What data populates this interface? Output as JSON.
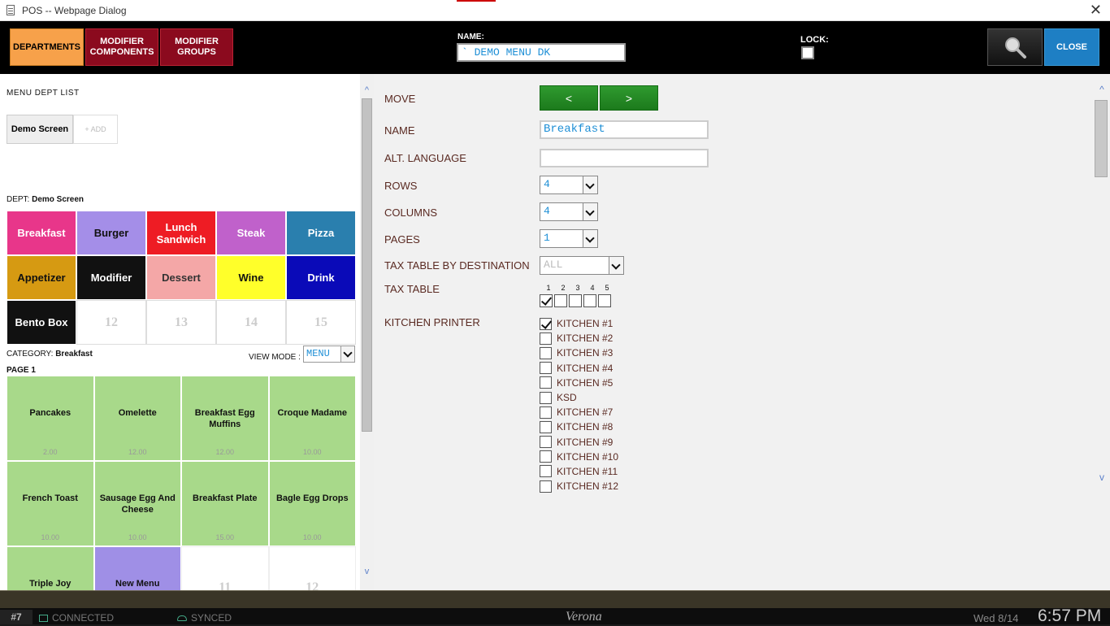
{
  "window": {
    "title": "POS -- Webpage Dialog"
  },
  "toolbar": {
    "departments": "DEPARTMENTS",
    "modifier_components": "MODIFIER COMPONENTS",
    "modifier_groups": "MODIFIER GROUPS",
    "name_label": "NAME:",
    "name_value": "` DEMO MENU DK",
    "lock_label": "LOCK:",
    "close": "CLOSE"
  },
  "left": {
    "menu_dept_list": "MENU DEPT LIST",
    "tab_demo": "Demo Screen",
    "tab_add": "+ ADD",
    "dept_prefix": "DEPT: ",
    "dept_value": "Demo Screen",
    "departments": [
      {
        "label": "Breakfast",
        "color": "#e8368a"
      },
      {
        "label": "Burger",
        "color": "#a48ee8",
        "text": "#111"
      },
      {
        "label": "Lunch Sandwich",
        "color": "#ee1c24"
      },
      {
        "label": "Steak",
        "color": "#c061cb"
      },
      {
        "label": "Pizza",
        "color": "#2a7fae"
      },
      {
        "label": "Appetizer",
        "color": "#d69a12",
        "text": "#111"
      },
      {
        "label": "Modifier",
        "color": "#111111"
      },
      {
        "label": "Dessert",
        "color": "#f4a7a7",
        "text": "#333"
      },
      {
        "label": "Wine",
        "color": "#ffff2a",
        "text": "#111"
      },
      {
        "label": "Drink",
        "color": "#0a0ab8"
      },
      {
        "label": "Bento Box",
        "color": "#111111"
      },
      {
        "label": "12",
        "empty": true
      },
      {
        "label": "13",
        "empty": true
      },
      {
        "label": "14",
        "empty": true
      },
      {
        "label": "15",
        "empty": true
      }
    ],
    "category_prefix": "CATEGORY: ",
    "category_value": "Breakfast",
    "view_mode_label": "VIEW MODE :",
    "view_mode_value": "MENU",
    "page_label": "PAGE 1",
    "items": [
      {
        "name": "Pancakes",
        "price": "2.00"
      },
      {
        "name": "Omelette",
        "price": "12.00"
      },
      {
        "name": "Breakfast Egg Muffins",
        "price": "12.00"
      },
      {
        "name": "Croque Madame",
        "price": "10.00"
      },
      {
        "name": "French Toast",
        "price": "10.00"
      },
      {
        "name": "Sausage Egg And Cheese",
        "price": "10.00"
      },
      {
        "name": "Breakfast Plate",
        "price": "15.00"
      },
      {
        "name": "Bagle Egg Drops",
        "price": "10.00"
      },
      {
        "name": "Triple Joy",
        "price": ""
      },
      {
        "name": "New Menu",
        "price": "",
        "purple": true
      },
      {
        "name": "11",
        "empty": true
      },
      {
        "name": "12",
        "empty": true
      }
    ]
  },
  "right": {
    "move_label": "MOVE",
    "move_left": "<",
    "move_right": ">",
    "name_label": "NAME",
    "name_value": "Breakfast",
    "alt_language_label": "ALT. LANGUAGE",
    "alt_language_value": "",
    "rows_label": "ROWS",
    "rows_value": "4",
    "columns_label": "COLUMNS",
    "columns_value": "4",
    "pages_label": "PAGES",
    "pages_value": "1",
    "tax_dest_label": "TAX TABLE BY DESTINATION",
    "tax_dest_value": "ALL",
    "tax_table_label": "TAX TABLE",
    "tax_numbers": [
      "1",
      "2",
      "3",
      "4",
      "5"
    ],
    "tax_checked": [
      true,
      false,
      false,
      false,
      false
    ],
    "kitchen_printer_label": "KITCHEN PRINTER",
    "kitchens": [
      {
        "label": "KITCHEN #1",
        "checked": true
      },
      {
        "label": "KITCHEN #2",
        "checked": false
      },
      {
        "label": "KITCHEN #3",
        "checked": false
      },
      {
        "label": "KITCHEN #4",
        "checked": false
      },
      {
        "label": "KITCHEN #5",
        "checked": false
      },
      {
        "label": "KSD",
        "checked": false
      },
      {
        "label": "KITCHEN #7",
        "checked": false
      },
      {
        "label": "KITCHEN #8",
        "checked": false
      },
      {
        "label": "KITCHEN #9",
        "checked": false
      },
      {
        "label": "KITCHEN #10",
        "checked": false
      },
      {
        "label": "KITCHEN #11",
        "checked": false
      },
      {
        "label": "KITCHEN #12",
        "checked": false
      }
    ]
  },
  "status": {
    "station": "#7",
    "connected": "CONNECTED",
    "synced": "SYNCED",
    "brand": "Verona",
    "date": "Wed 8/14",
    "time": "6:57 PM"
  }
}
